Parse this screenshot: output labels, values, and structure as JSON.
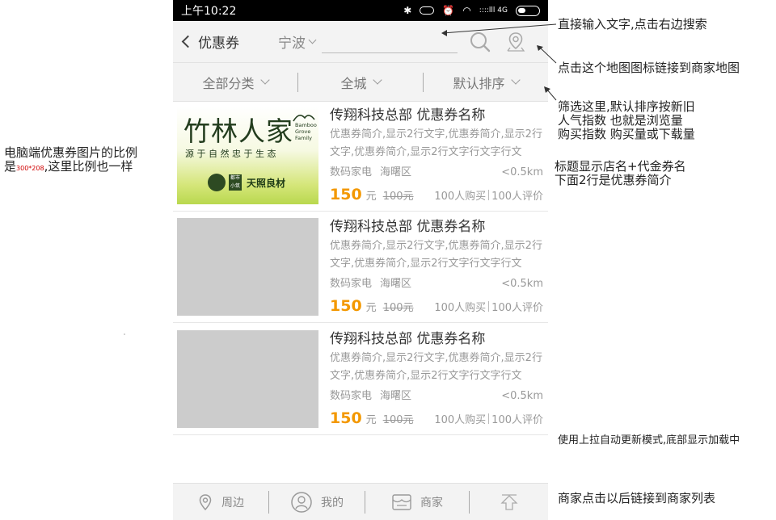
{
  "status_bar": {
    "time": "上午10:22",
    "network": "::::lll 4G"
  },
  "header": {
    "back_label": "优惠券",
    "city": "宁波",
    "search_value": "",
    "icons": [
      "search-icon",
      "map-pin-icon"
    ]
  },
  "filters": {
    "category": "全部分类",
    "area": "全城",
    "sort": "默认排序"
  },
  "coupons": [
    {
      "title": "传翔科技总部 优惠券名称",
      "desc": "优惠券简介,显示2行文字,优惠券简介,显示2行文字,优惠券简介,显示2行文字行文字行文",
      "category": "数码家电",
      "district": "海曙区",
      "distance": "<0.5km",
      "price": "150",
      "unit": "元",
      "original_price": "100元",
      "buyers": "100人购买",
      "reviews": "100人评价",
      "image": {
        "brand_cn": "竹林人家",
        "brand_en_1": "Bamboo",
        "brand_en_2": "Grove",
        "brand_en_3": "Family",
        "slogan": "源 于 自 然   忠 于 生 态",
        "badge": "天照良材",
        "badge_small": "都市小筑"
      }
    },
    {
      "title": "传翔科技总部 优惠券名称",
      "desc": "优惠券简介,显示2行文字,优惠券简介,显示2行文字,优惠券简介,显示2行文字行文字行文",
      "category": "数码家电",
      "district": "海曙区",
      "distance": "<0.5km",
      "price": "150",
      "unit": "元",
      "original_price": "100元",
      "buyers": "100人购买",
      "reviews": "100人评价"
    },
    {
      "title": "传翔科技总部 优惠券名称",
      "desc": "优惠券简介,显示2行文字,优惠券简介,显示2行文字,优惠券简介,显示2行文字行文字行文",
      "category": "数码家电",
      "district": "海曙区",
      "distance": "<0.5km",
      "price": "150",
      "unit": "元",
      "original_price": "100元",
      "buyers": "100人购买",
      "reviews": "100人评价"
    }
  ],
  "bottom_nav": [
    {
      "label": "周边",
      "icon": "location-icon"
    },
    {
      "label": "我的",
      "icon": "user-icon"
    },
    {
      "label": "商家",
      "icon": "shop-icon"
    },
    {
      "label": "",
      "icon": "back-to-top-icon"
    }
  ],
  "annotations": {
    "left_note_1": "电脑端优惠券图片的比例",
    "left_note_2_a": "是",
    "left_note_2_ratio": "300*208",
    "left_note_2_b": ",这里比例也一样",
    "search_note": "直接输入文字,点击右边搜索",
    "map_note": "点击这个地图图标链接到商家地图",
    "filter_note_1": "筛选这里,默认排序按新旧",
    "filter_note_2": "人气指数  也就是浏览量",
    "filter_note_3": "购买指数  购买量或下载量",
    "title_note_1": "标题显示店名+代金券名",
    "title_note_2": "下面2行是优惠券简介",
    "loading_note": "使用上拉自动更新模式,底部显示加载中",
    "shop_note": "商家点击以后链接到商家列表"
  },
  "colors": {
    "price": "#f39800",
    "placeholder_image": "#cccccc",
    "bar_background": "#f3f3f3",
    "ratio_text": "#d00000"
  }
}
